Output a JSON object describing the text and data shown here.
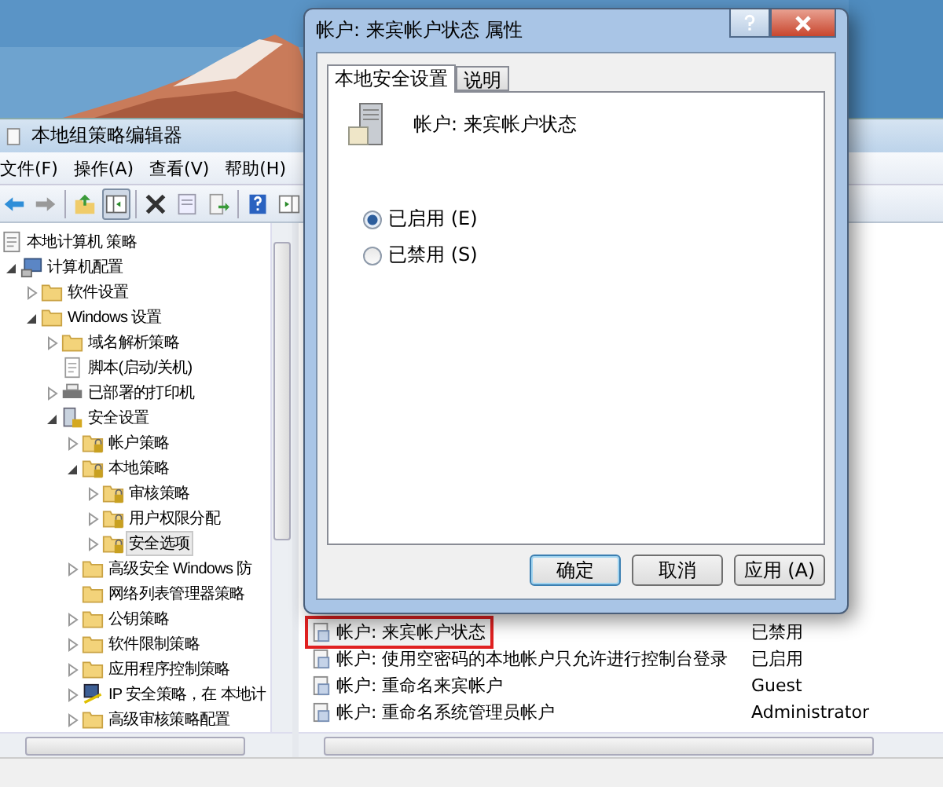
{
  "editor": {
    "title": "本地组策略编辑器",
    "menu": [
      "文件(F)",
      "操作(A)",
      "查看(V)",
      "帮助(H)"
    ],
    "tree": [
      {
        "label": "本地计算机 策略",
        "kind": "policy",
        "children": [
          {
            "label": "计算机配置",
            "kind": "computer",
            "expanded": true,
            "children": [
              {
                "label": "软件设置",
                "kind": "folder",
                "expanded": false
              },
              {
                "label": "Windows 设置",
                "kind": "folder",
                "expanded": true,
                "children": [
                  {
                    "label": "域名解析策略",
                    "kind": "folder",
                    "expanded": false
                  },
                  {
                    "label": "脚本(启动/关机)",
                    "kind": "script"
                  },
                  {
                    "label": "已部署的打印机",
                    "kind": "printer",
                    "expanded": false
                  },
                  {
                    "label": "安全设置",
                    "kind": "secure",
                    "expanded": true,
                    "children": [
                      {
                        "label": "帐户策略",
                        "kind": "lockfolder",
                        "expanded": false
                      },
                      {
                        "label": "本地策略",
                        "kind": "lockfolder",
                        "expanded": true,
                        "children": [
                          {
                            "label": "审核策略",
                            "kind": "lockfolder",
                            "expanded": false
                          },
                          {
                            "label": "用户权限分配",
                            "kind": "lockfolder",
                            "expanded": false
                          },
                          {
                            "label": "安全选项",
                            "kind": "lockfolder",
                            "expanded": false,
                            "selected": true
                          }
                        ]
                      },
                      {
                        "label": "高级安全 Windows 防",
                        "kind": "folder",
                        "expanded": false
                      },
                      {
                        "label": "网络列表管理器策略",
                        "kind": "folder"
                      },
                      {
                        "label": "公钥策略",
                        "kind": "folder",
                        "expanded": false
                      },
                      {
                        "label": "软件限制策略",
                        "kind": "folder",
                        "expanded": false
                      },
                      {
                        "label": "应用程序控制策略",
                        "kind": "folder",
                        "expanded": false
                      },
                      {
                        "label": "IP 安全策略，在 本地计",
                        "kind": "ipsec",
                        "expanded": false
                      },
                      {
                        "label": "高级审核策略配置",
                        "kind": "folder",
                        "expanded": false
                      }
                    ]
                  }
                ]
              }
            ]
          }
        ]
      }
    ],
    "rows": [
      {
        "name": "帐户: 来宾帐户状态",
        "value": "已禁用",
        "marked": true
      },
      {
        "name": "帐户: 使用空密码的本地帐户只允许进行控制台登录",
        "value": "已启用",
        "marked": false
      },
      {
        "name": "帐户: 重命名来宾帐户",
        "value": "Guest",
        "marked": false
      },
      {
        "name": "帐户: 重命名系统管理员帐户",
        "value": "Administrator",
        "marked": false
      }
    ]
  },
  "dialog": {
    "title": "帐户: 来宾帐户状态 属性",
    "tabs": [
      {
        "label": "本地安全设置",
        "selected": true
      },
      {
        "label": "说明",
        "selected": false
      }
    ],
    "policy_name": "帐户: 来宾帐户状态",
    "options": [
      {
        "label": "已启用 (E)",
        "selected": true
      },
      {
        "label": "已禁用 (S)",
        "selected": false
      }
    ],
    "buttons": [
      {
        "label": "确定",
        "default": true
      },
      {
        "label": "取消",
        "default": false
      },
      {
        "label": "应用 (A)",
        "default": false
      }
    ]
  }
}
